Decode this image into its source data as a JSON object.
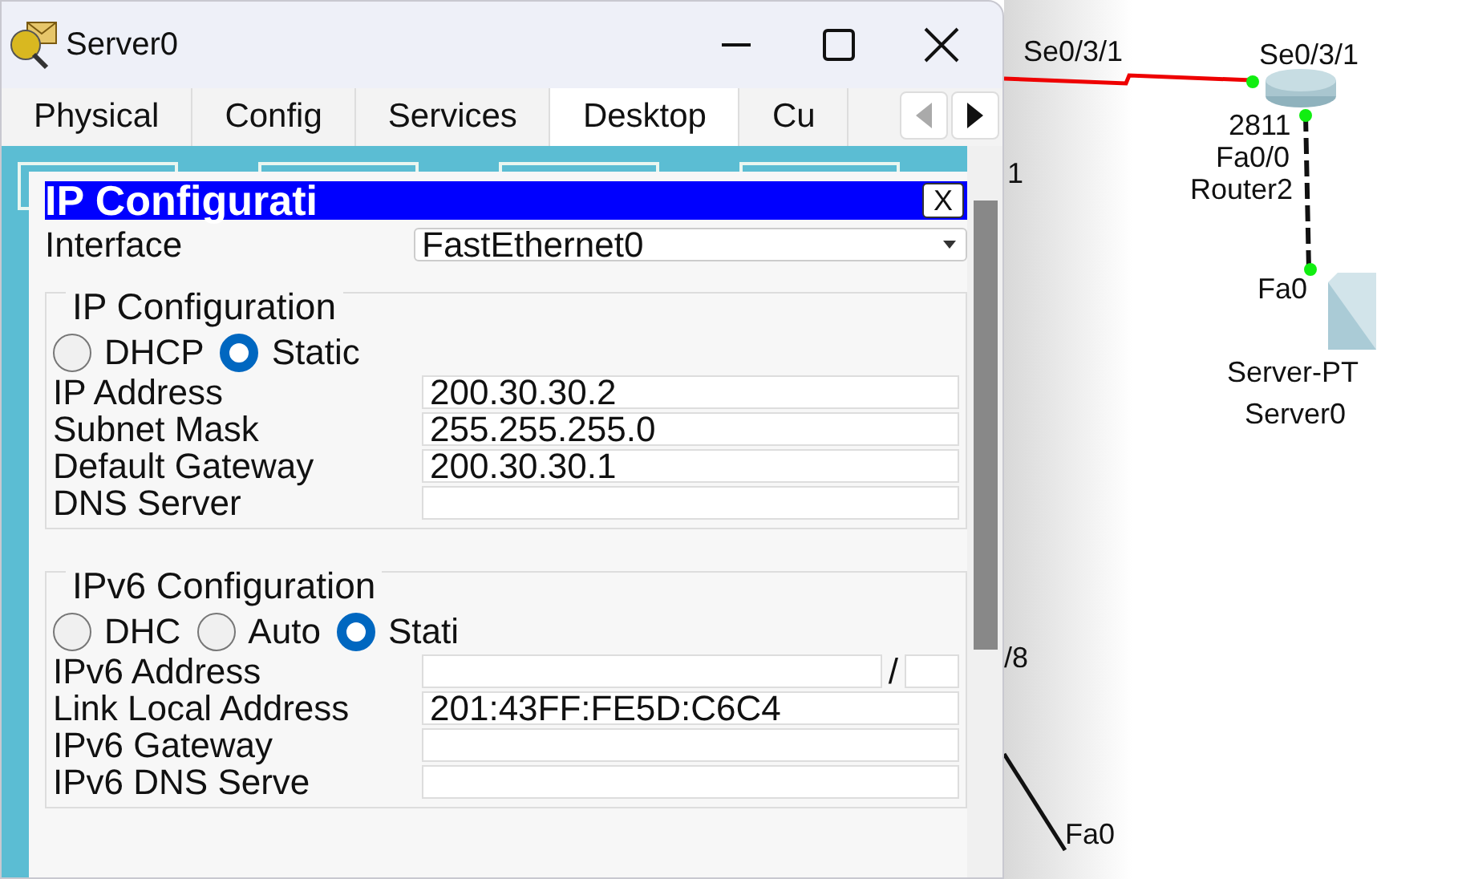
{
  "window": {
    "title": "Server0",
    "tabs": [
      {
        "label": "Physical",
        "selected": false
      },
      {
        "label": "Config",
        "selected": false
      },
      {
        "label": "Services",
        "selected": false
      },
      {
        "label": "Desktop",
        "selected": true
      },
      {
        "label": "Cu",
        "selected": false
      }
    ]
  },
  "dialog": {
    "title": "IP Configurati",
    "close": "X",
    "interface": {
      "label": "Interface",
      "value": "FastEthernet0"
    },
    "ipv4": {
      "legend": "IP Configuration",
      "modes": [
        {
          "label": "DHCP",
          "selected": false
        },
        {
          "label": "Static",
          "selected": true
        }
      ],
      "fields": [
        {
          "label": "IP Address",
          "value": "200.30.30.2"
        },
        {
          "label": "Subnet Mask",
          "value": "255.255.255.0"
        },
        {
          "label": "Default Gateway",
          "value": "200.30.30.1"
        },
        {
          "label": "DNS Server"
        }
      ]
    },
    "ipv6": {
      "legend": "IPv6 Configuration",
      "modes": [
        {
          "label": "DHC",
          "selected": false
        },
        {
          "label": "Auto",
          "selected": false
        },
        {
          "label": "Stati",
          "selected": true
        }
      ],
      "fields": [
        {
          "label": "IPv6 Address",
          "suffix": "/"
        },
        {
          "label": "Link Local Address",
          "value": "201:43FF:FE5D:C6C4"
        },
        {
          "label": "IPv6 Gateway"
        },
        {
          "label": "IPv6 DNS Serve"
        }
      ]
    }
  },
  "topology": {
    "labels": [
      {
        "text": "Se0/3/1"
      },
      {
        "text": "Se0/3/1"
      },
      {
        "text": "2811"
      },
      {
        "text": "Fa0/0"
      },
      {
        "text": "Router2"
      },
      {
        "text": "Fa0"
      },
      {
        "text": "Server-PT"
      },
      {
        "text": "Server0"
      },
      {
        "text": "1"
      },
      {
        "text": "/8"
      },
      {
        "text": "Fa0"
      }
    ]
  }
}
